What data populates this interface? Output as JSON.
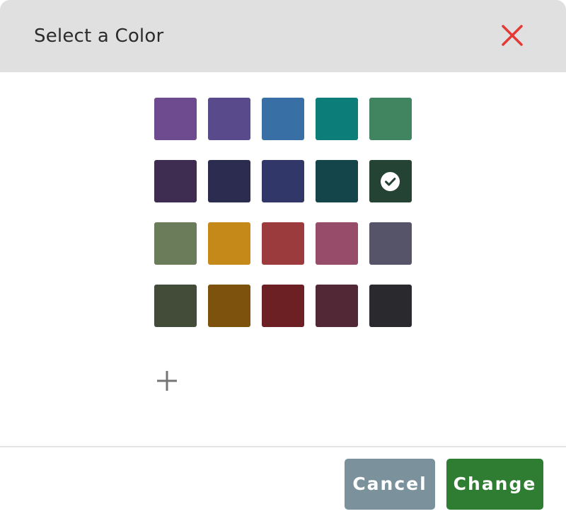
{
  "dialog": {
    "title": "Select a Color",
    "close_icon": "close-icon",
    "add_icon": "plus-icon",
    "selected_index": 9,
    "swatches": [
      "#6e4a8e",
      "#584a8b",
      "#3870a6",
      "#0d7d7a",
      "#40855f",
      "#3f2c51",
      "#2b2c4f",
      "#313869",
      "#13454a",
      "#254334",
      "#6b7c5b",
      "#c48919",
      "#9b3b3e",
      "#974d6a",
      "#555468",
      "#434c38",
      "#7c520c",
      "#6c2024",
      "#532836",
      "#29292e"
    ],
    "buttons": {
      "cancel_label": "Cancel",
      "change_label": "Change"
    },
    "colors": {
      "header_bg": "#e0e0e0",
      "close": "#e53935",
      "cancel_bg": "#7b929d",
      "change_bg": "#2e7d32"
    }
  }
}
